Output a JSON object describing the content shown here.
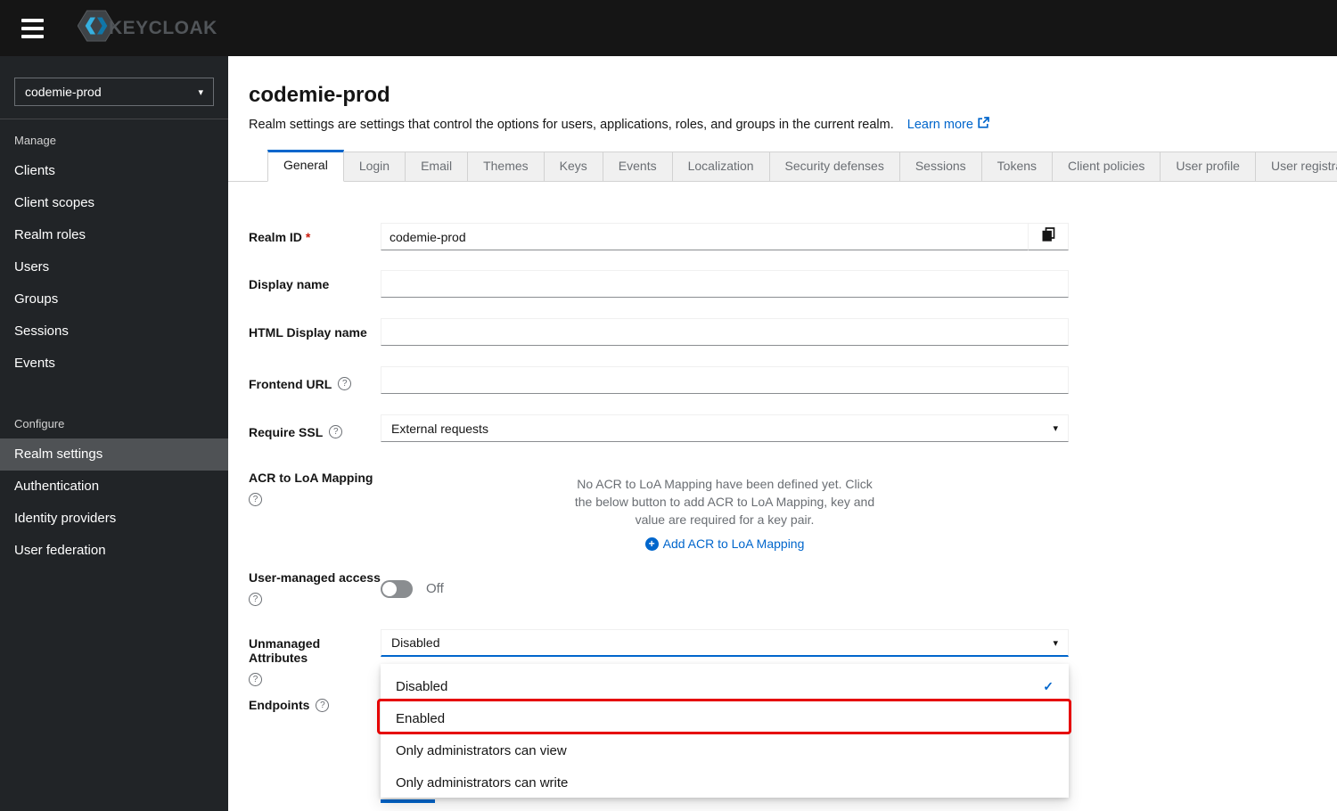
{
  "masthead": {
    "logo_text": "KEYCLOAK"
  },
  "sidebar": {
    "realm_selector": {
      "value": "codemie-prod"
    },
    "sections": [
      {
        "label": "Manage",
        "items": [
          "Clients",
          "Client scopes",
          "Realm roles",
          "Users",
          "Groups",
          "Sessions",
          "Events"
        ]
      },
      {
        "label": "Configure",
        "items": [
          "Realm settings",
          "Authentication",
          "Identity providers",
          "User federation"
        ],
        "selected": "Realm settings"
      }
    ]
  },
  "header": {
    "title": "codemie-prod",
    "description": "Realm settings are settings that control the options for users, applications, roles, and groups in the current realm.",
    "learn_more_label": "Learn more"
  },
  "tabs": {
    "active": "General",
    "items": [
      "General",
      "Login",
      "Email",
      "Themes",
      "Keys",
      "Events",
      "Localization",
      "Security defenses",
      "Sessions",
      "Tokens",
      "Client policies",
      "User profile",
      "User registration"
    ]
  },
  "form": {
    "required_indicator": "*",
    "realm_id": {
      "label": "Realm ID",
      "value": "codemie-prod"
    },
    "display_name": {
      "label": "Display name",
      "value": ""
    },
    "html_display_name": {
      "label": "HTML Display name",
      "value": ""
    },
    "frontend_url": {
      "label": "Frontend URL",
      "value": ""
    },
    "require_ssl": {
      "label": "Require SSL",
      "value": "External requests"
    },
    "acr_to_loa_mapping": {
      "label": "ACR to LoA Mapping",
      "empty_text": "No ACR to LoA Mapping have been defined yet. Click the below button to add ACR to LoA Mapping, key and value are required for a key pair.",
      "add_button_label": "Add ACR to LoA Mapping"
    },
    "user_managed_access": {
      "label": "User-managed access",
      "state_label": "Off"
    },
    "unmanaged_attributes": {
      "label": "Unmanaged Attributes",
      "value": "Disabled"
    },
    "endpoints": {
      "label": "Endpoints"
    }
  },
  "unmanaged_attributes_dropdown": {
    "options": [
      {
        "label": "Disabled",
        "selected": true
      },
      {
        "label": "Enabled",
        "annotated": true
      },
      {
        "label": "Only administrators can view"
      },
      {
        "label": "Only administrators can write"
      }
    ]
  },
  "icons": {
    "caret_down": "▾",
    "check": "✓",
    "question_mark": "?",
    "plus": "+"
  },
  "colors": {
    "accent_blue": "#0066cc",
    "annotation_red": "#e60000",
    "masthead_bg": "#151515",
    "sidebar_bg": "#212427",
    "sidebar_selected_bg": "#4f5255"
  }
}
